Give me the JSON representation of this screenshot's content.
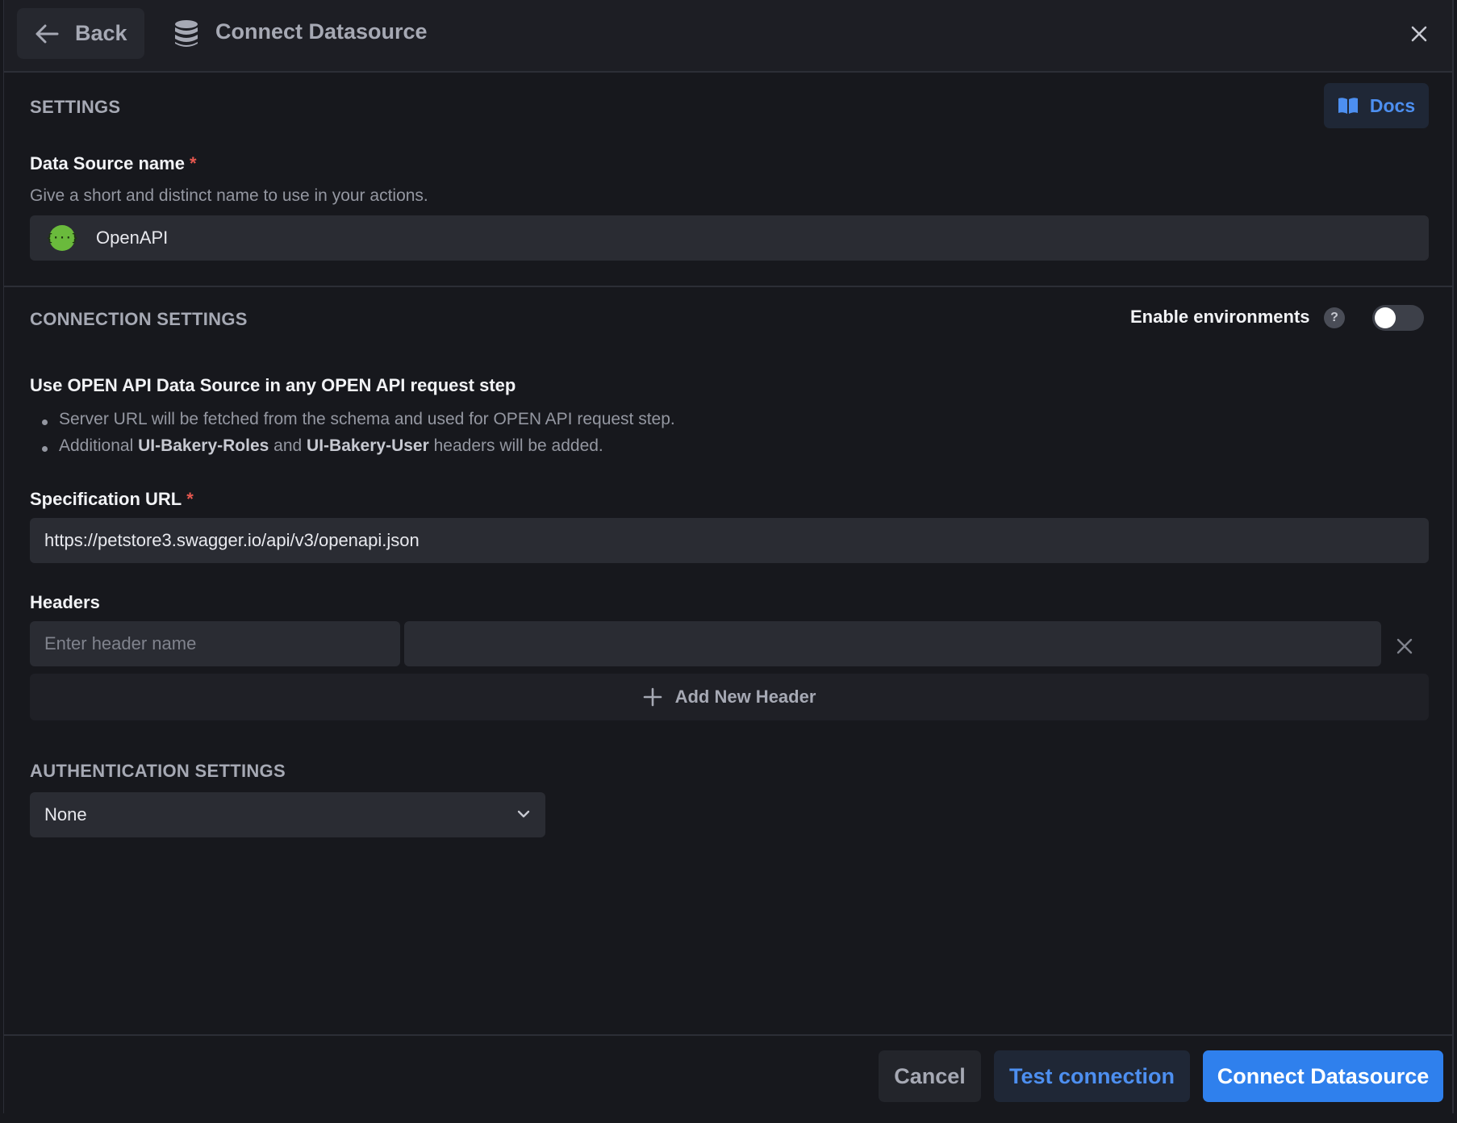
{
  "header": {
    "back_label": "Back",
    "title": "Connect Datasource"
  },
  "settings": {
    "section_label": "SETTINGS",
    "docs_label": "Docs",
    "name_label": "Data Source name",
    "required_mark": "*",
    "name_hint": "Give a short and distinct name to use in your actions.",
    "name_value": "OpenAPI",
    "name_icon_glyph": "{···}"
  },
  "connection": {
    "section_label": "CONNECTION SETTINGS",
    "env_label": "Enable environments",
    "env_help": "?",
    "env_enabled": false,
    "info_title": "Use OPEN API Data Source in any OPEN API request step",
    "bullet1": "Server URL will be fetched from the schema and used for OPEN API request step.",
    "bullet2_prefix": "Additional ",
    "bullet2_roles": "UI-Bakery-Roles",
    "bullet2_and": " and ",
    "bullet2_user": "UI-Bakery-User",
    "bullet2_suffix": " headers will be added.",
    "spec_label": "Specification URL",
    "spec_value": "https://petstore3.swagger.io/api/v3/openapi.json",
    "headers_label": "Headers",
    "header_name_placeholder": "Enter header name",
    "header_value": "",
    "add_header_label": "Add New Header"
  },
  "auth": {
    "section_label": "AUTHENTICATION SETTINGS",
    "selected": "None"
  },
  "footer": {
    "cancel_label": "Cancel",
    "test_label": "Test connection",
    "connect_label": "Connect Datasource"
  },
  "colors": {
    "accent": "#2f80ed",
    "background": "#17181d",
    "input": "#2a2c33",
    "required": "#e6574f",
    "openapi_icon": "#6aba3c"
  }
}
